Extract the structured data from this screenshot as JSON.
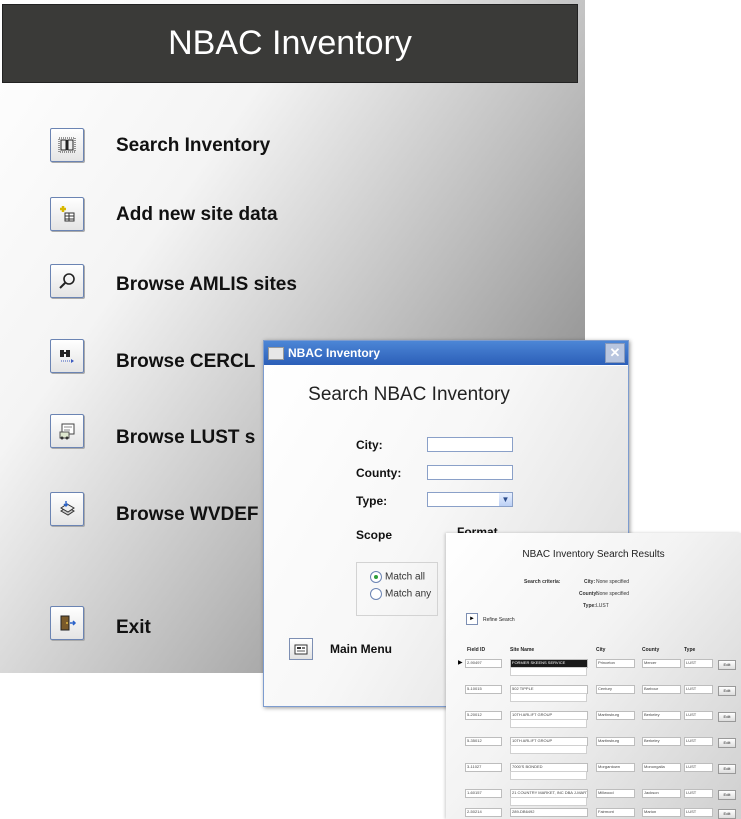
{
  "main": {
    "title": "NBAC Inventory",
    "items": [
      {
        "label": "Search Inventory",
        "icon": "open-book-icon"
      },
      {
        "label": "Add new site data",
        "icon": "add-record-icon"
      },
      {
        "label": "Browse AMLIS sites",
        "icon": "magnifier-icon"
      },
      {
        "label": "Browse CERCL",
        "icon": "binoculars-icon"
      },
      {
        "label": "Browse LUST s",
        "icon": "report-icon"
      },
      {
        "label": "Browse WVDEF",
        "icon": "stacked-forms-icon"
      },
      {
        "label": "Exit",
        "icon": "exit-door-icon"
      }
    ]
  },
  "search": {
    "window_title": "NBAC Inventory",
    "close_glyph": "✕",
    "heading": "Search NBAC Inventory",
    "city_label": "City:",
    "county_label": "County:",
    "type_label": "Type:",
    "city_value": "",
    "county_value": "",
    "type_value": "",
    "scope_label": "Scope",
    "format_label": "Format",
    "scope_options": [
      "Match all",
      "Match any"
    ],
    "scope_selected": "Match all",
    "main_menu_label": "Main Menu"
  },
  "results": {
    "title": "NBAC Inventory Search Results",
    "criteria_label": "Search criteria:",
    "city_label": "City:",
    "city_value": "None specified",
    "county_label": "County:",
    "county_value": "None specified",
    "type_label": "Type:",
    "type_value": "LUST",
    "refine_label": "Refine Search",
    "columns": [
      "Field ID",
      "Site Name",
      "City",
      "County",
      "Type"
    ],
    "edit_label": "Edit",
    "rows": [
      {
        "id": "2-90497",
        "site": "FORMER SKEENS SERVICE",
        "city": "Princeton",
        "county": "Mercer",
        "type": "LUST"
      },
      {
        "id": "5-10015",
        "site": "502 TIPPLE",
        "city": "Century",
        "county": "Barbour",
        "type": "LUST"
      },
      {
        "id": "5-20012",
        "site": "10TH ARLIFT GROUP",
        "city": "Martinsburg",
        "county": "Berkeley",
        "type": "LUST"
      },
      {
        "id": "5-35012",
        "site": "10TH ARLIFT GROUP",
        "city": "Martinsburg",
        "county": "Berkeley",
        "type": "LUST"
      },
      {
        "id": "3-11027",
        "site": "7000'S BONDED",
        "city": "Morgantown",
        "county": "Monongalia",
        "type": "LUST"
      },
      {
        "id": "1-60157",
        "site": "21 COUNTRY MARKET, INC DBA J-MART",
        "city": "Millwood",
        "county": "Jackson",
        "type": "LUST"
      },
      {
        "id": "2-50214",
        "site": "289-DB6492",
        "city": "Fairmont",
        "county": "Marion",
        "type": "LUST"
      }
    ]
  }
}
